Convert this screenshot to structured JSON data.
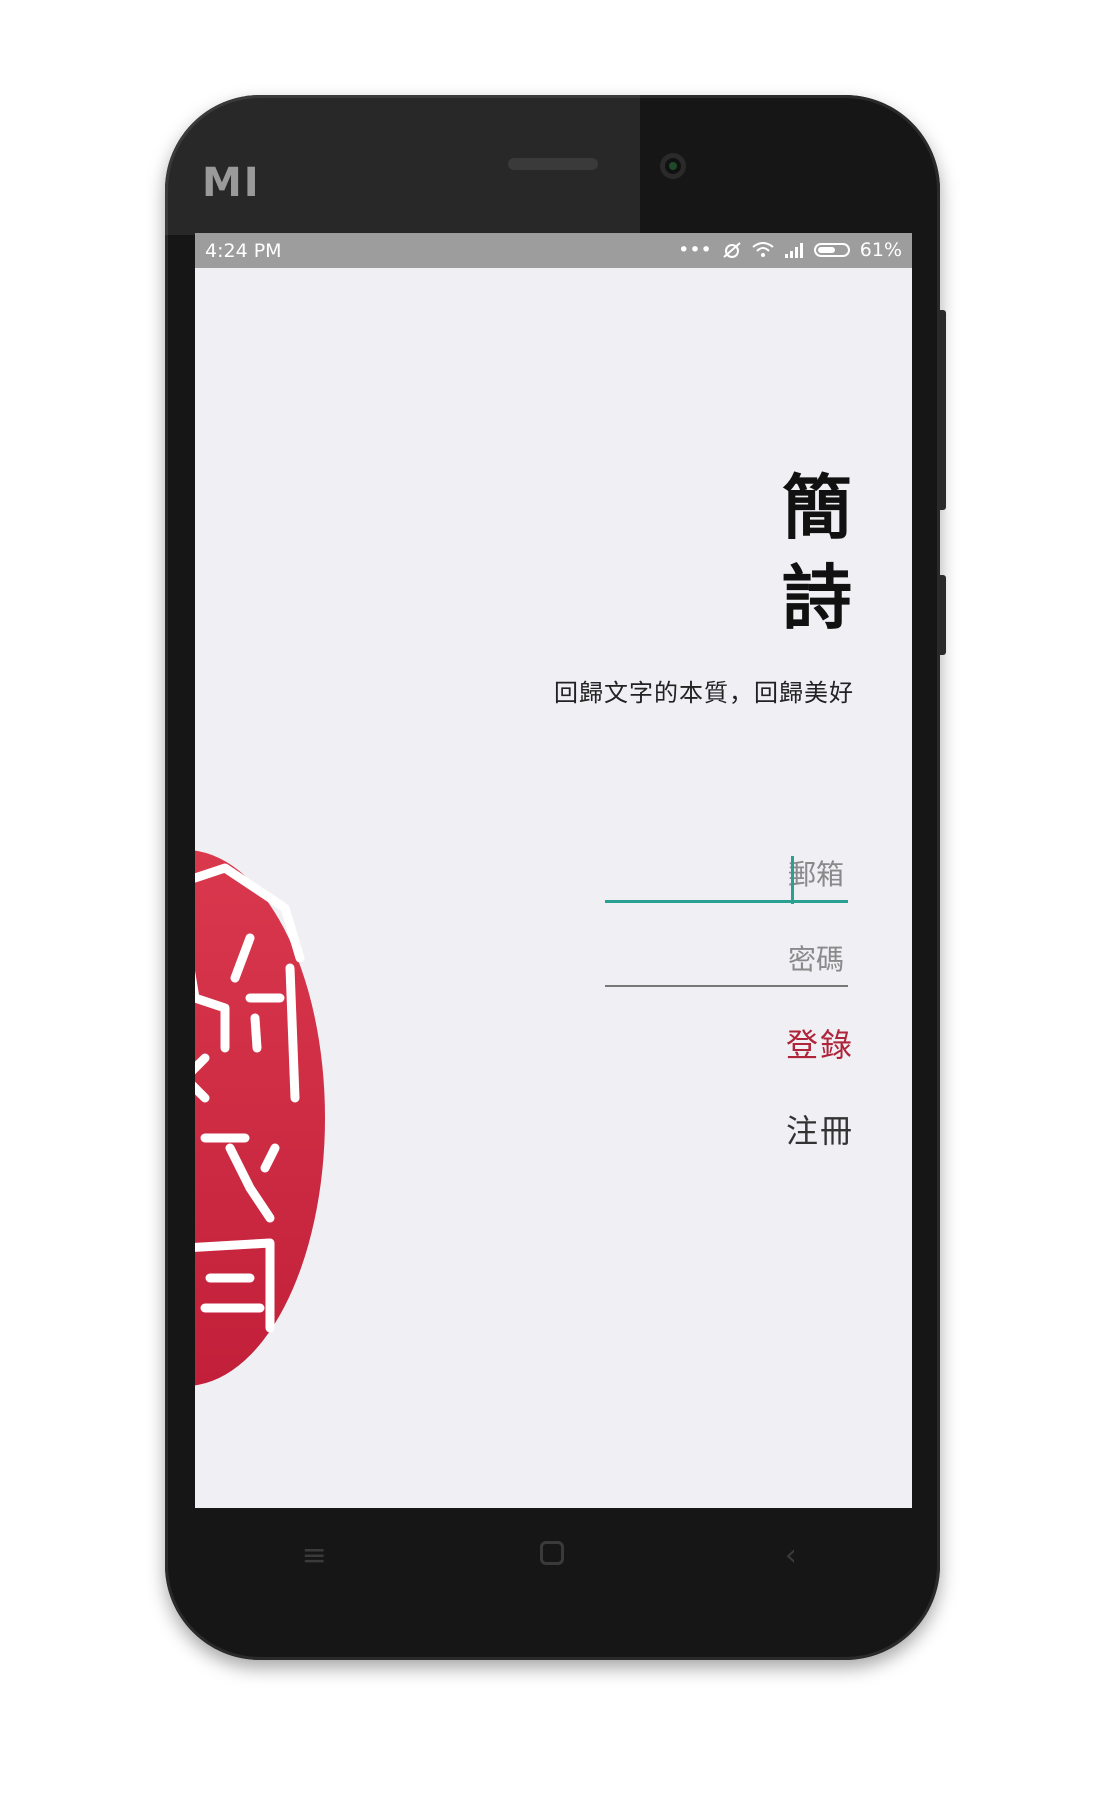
{
  "device": {
    "brand": "MI"
  },
  "status_bar": {
    "time": "4:24 PM",
    "icons": [
      "more-dots-icon",
      "muted-alarm-icon",
      "wifi-icon",
      "signal-icon",
      "battery-icon"
    ],
    "battery_level": 0.61,
    "battery_text": "61%"
  },
  "app": {
    "title_chars": [
      "簡",
      "詩"
    ],
    "subtitle": "回歸文字的本質，回歸美好",
    "seal_logo": "簡詩",
    "colors": {
      "accent": "#2aa090",
      "seal_red": "#c92a42",
      "login": "#b0243a",
      "background": "#efeff4"
    }
  },
  "form": {
    "email": {
      "placeholder": "郵箱",
      "value": ""
    },
    "password": {
      "placeholder": "密碼",
      "value": ""
    },
    "login_label": "登錄",
    "register_label": "注冊"
  },
  "nav": {
    "icons": [
      "menu-icon",
      "home-icon",
      "back-icon"
    ]
  }
}
